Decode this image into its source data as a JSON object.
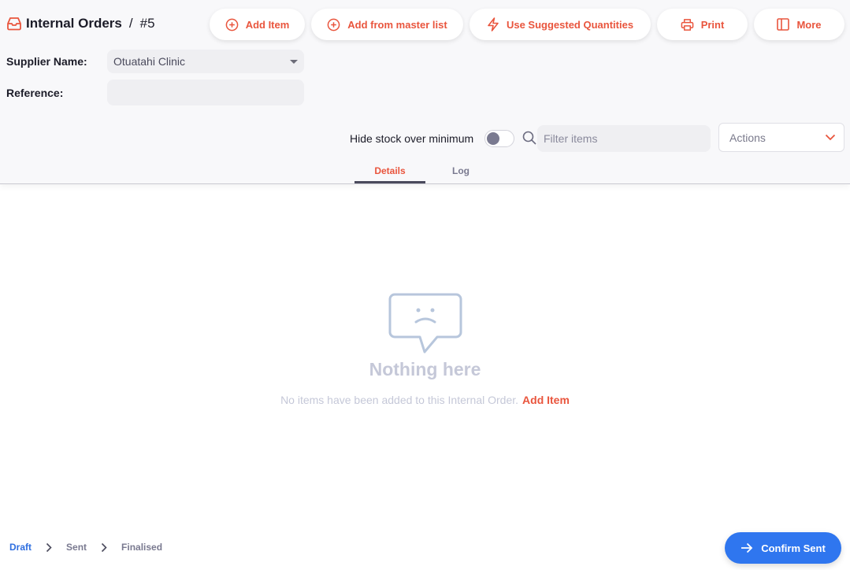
{
  "header": {
    "title": "Internal Orders",
    "separator": "/",
    "order_number": "#5",
    "title_icon": "inbox-tray-icon"
  },
  "toolbar": {
    "add_item_label": "Add Item",
    "add_from_master_list_label": "Add from master list",
    "use_suggested_quantities_label": "Use Suggested Quantities",
    "print_label": "Print",
    "more_label": "More"
  },
  "form": {
    "supplier_label": "Supplier Name:",
    "supplier_value": "Otuatahi Clinic",
    "reference_label": "Reference:",
    "reference_value": ""
  },
  "filters": {
    "hide_stock_label": "Hide stock over minimum",
    "hide_stock_enabled": false,
    "filter_placeholder": "Filter items",
    "actions_label": "Actions"
  },
  "tabs": [
    {
      "label": "Details",
      "active": true
    },
    {
      "label": "Log",
      "active": false
    }
  ],
  "empty_state": {
    "title": "Nothing here",
    "message": "No items have been added to this Internal Order.",
    "link_label": "Add Item"
  },
  "footer": {
    "steps": [
      {
        "label": "Draft",
        "active": true
      },
      {
        "label": "Sent",
        "active": false
      },
      {
        "label": "Finalised",
        "active": false
      }
    ],
    "confirm_label": "Confirm Sent"
  },
  "colors": {
    "accent": "#e9553d",
    "primary": "#2f76ef",
    "muted": "#c5c8d8"
  }
}
